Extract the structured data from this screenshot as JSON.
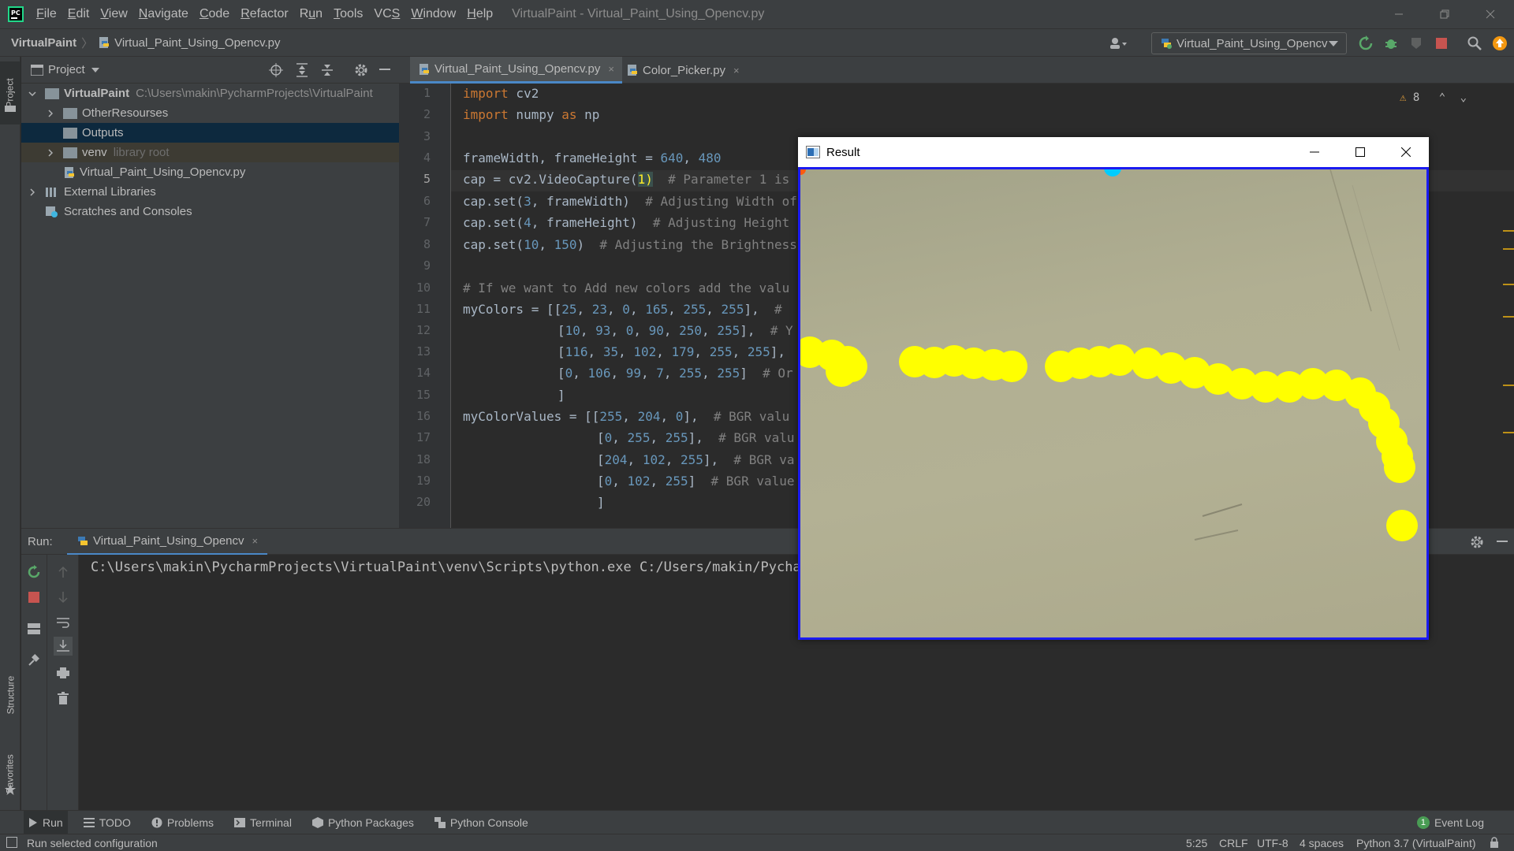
{
  "menubar": {
    "items": [
      {
        "pre": "",
        "u": "F",
        "post": "ile"
      },
      {
        "pre": "",
        "u": "E",
        "post": "dit"
      },
      {
        "pre": "",
        "u": "V",
        "post": "iew"
      },
      {
        "pre": "",
        "u": "N",
        "post": "avigate"
      },
      {
        "pre": "",
        "u": "C",
        "post": "ode"
      },
      {
        "pre": "",
        "u": "R",
        "post": "efactor"
      },
      {
        "pre": "R",
        "u": "u",
        "post": "n"
      },
      {
        "pre": "",
        "u": "T",
        "post": "ools"
      },
      {
        "pre": "VC",
        "u": "S",
        "post": ""
      },
      {
        "pre": "",
        "u": "W",
        "post": "indow"
      },
      {
        "pre": "",
        "u": "H",
        "post": "elp"
      }
    ],
    "window_title": "VirtualPaint - Virtual_Paint_Using_Opencv.py"
  },
  "navbar": {
    "project": "VirtualPaint",
    "separator": "〉",
    "file": "Virtual_Paint_Using_Opencv.py",
    "run_config": "Virtual_Paint_Using_Opencv"
  },
  "left_strip": {
    "project": "Project",
    "structure": "Structure",
    "favorites": "Favorites"
  },
  "project_panel": {
    "title": "Project",
    "tree": [
      {
        "label": "VirtualPaint",
        "path": "C:\\Users\\makin\\PycharmProjects\\VirtualPaint"
      },
      {
        "label": "OtherResourses"
      },
      {
        "label": "Outputs"
      },
      {
        "label": "venv",
        "hint": "library root"
      },
      {
        "label": "Virtual_Paint_Using_Opencv.py"
      },
      {
        "label": "External Libraries"
      },
      {
        "label": "Scratches and Consoles"
      }
    ]
  },
  "editor": {
    "tabs": [
      {
        "label": "Virtual_Paint_Using_Opencv.py",
        "close": "×"
      },
      {
        "label": "Color_Picker.py",
        "close": "×"
      }
    ],
    "line_numbers": [
      "1",
      "2",
      "3",
      "4",
      "5",
      "6",
      "7",
      "8",
      "9",
      "10",
      "11",
      "12",
      "13",
      "14",
      "15",
      "16",
      "17",
      "18",
      "19",
      "20"
    ],
    "current_line": "5",
    "warnings": "8",
    "code": {
      "l1_kw": "import",
      "l1_rest": " cv2",
      "l2_kw": "import",
      "l2_a": " numpy ",
      "l2_kw2": "as",
      "l2_b": " np",
      "l4_a": "frameWidth, frameHeight = ",
      "l4_n1": "640",
      "l4_b": ", ",
      "l4_n2": "480",
      "l5_a": "cap = cv2.VideoCapture(",
      "l5_hl": "1",
      "l5_b": ")",
      "l5_c": "  # Parameter 1 is",
      "l6_a": "cap.set(",
      "l6_n": "3",
      "l6_b": ", frameWidth)",
      "l6_c": "  # Adjusting Width of",
      "l7_a": "cap.set(",
      "l7_n": "4",
      "l7_b": ", frameHeight)",
      "l7_c": "  # Adjusting Height",
      "l8_a": "cap.set(",
      "l8_n1": "10",
      "l8_b": ", ",
      "l8_n2": "150",
      "l8_c": ")",
      "l8_d": "  # Adjusting the Brightness",
      "l10_c": "# If we want to Add new colors add the valu",
      "l11_a": "myColors = [[",
      "l11_nums": [
        "25",
        "23",
        "0",
        "165",
        "255",
        "255"
      ],
      "l11_c": "  #",
      "l12_nums": [
        "10",
        "93",
        "0",
        "90",
        "250",
        "255"
      ],
      "l12_c": "  # Y",
      "l13_nums": [
        "116",
        "35",
        "102",
        "179",
        "255",
        "255"
      ],
      "l13_c": ",",
      "l14_nums": [
        "0",
        "106",
        "99",
        "7",
        "255",
        "255"
      ],
      "l14_c": "  # Or",
      "l15": "]",
      "l16_a": "myColorValues = [[",
      "l16_nums": [
        "255",
        "204",
        "0"
      ],
      "l16_c": "  # BGR valu",
      "l17_nums": [
        "0",
        "255",
        "255"
      ],
      "l17_c": "  # BGR valu",
      "l18_nums": [
        "204",
        "102",
        "255"
      ],
      "l18_c": "  # BGR va",
      "l19_nums": [
        "0",
        "102",
        "255"
      ],
      "l19_c": "  # BGR value",
      "l20": "]"
    }
  },
  "run_panel": {
    "label": "Run:",
    "tab": "Virtual_Paint_Using_Opencv",
    "tab_close": "×",
    "console_line": "C:\\Users\\makin\\PycharmProjects\\VirtualPaint\\venv\\Scripts\\python.exe C:/Users/makin/Pycharm"
  },
  "bottom_tabs": {
    "run": "Run",
    "todo": "TODO",
    "problems": "Problems",
    "terminal": "Terminal",
    "python_packages": "Python Packages",
    "python_console": "Python Console",
    "event_log": "Event Log",
    "event_count": "1"
  },
  "statusbar": {
    "message": "Run selected configuration",
    "position": "5:25",
    "line_sep": "CRLF",
    "encoding": "UTF-8",
    "indent": "4 spaces",
    "interpreter": "Python 3.7 (VirtualPaint)"
  },
  "result_window": {
    "title": "Result",
    "paint_color": "#ffff00",
    "frame_border_color": "#1b1bf0"
  },
  "colors": {
    "accent": "#4a88c7",
    "keyword": "#cc7832",
    "number": "#6897bb",
    "comment": "#808080"
  }
}
